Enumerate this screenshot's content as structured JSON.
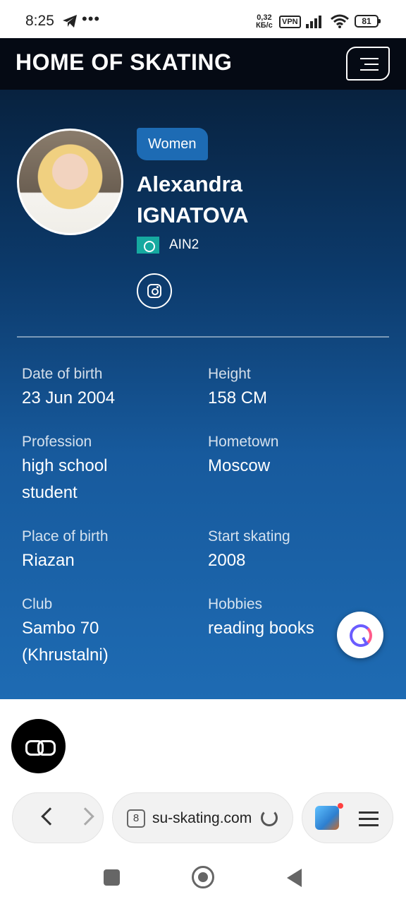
{
  "status_bar": {
    "time": "8:25",
    "dots": "•••",
    "speed_value": "0,32",
    "speed_unit": "КБ/c",
    "vpn": "VPN",
    "battery": "81",
    "icons": [
      "telegram-icon",
      "signal-icon",
      "wifi-icon",
      "battery-icon"
    ]
  },
  "header": {
    "site_title": "HOME OF SKATING",
    "menu_icon": "hamburger-icon"
  },
  "profile": {
    "category": "Women",
    "first_name": "Alexandra",
    "last_name": "IGNATOVA",
    "nation_code": "AIN2",
    "social_icon": "instagram-icon"
  },
  "info": [
    {
      "label": "Date of birth",
      "value": "23 Jun 2004"
    },
    {
      "label": "Height",
      "value": "158 CM"
    },
    {
      "label": "Profession",
      "value": "high school student"
    },
    {
      "label": "Hometown",
      "value": "Moscow"
    },
    {
      "label": "Place of birth",
      "value": "Riazan"
    },
    {
      "label": "Start skating",
      "value": "2008"
    },
    {
      "label": "Club",
      "value": "Sambo 70 (Khrustalni)"
    },
    {
      "label": "Hobbies",
      "value": "reading books"
    }
  ],
  "browser": {
    "tab_count": "8",
    "url": "su-skating.com"
  },
  "colors": {
    "header_bg": "#050a14",
    "hero_top": "#08223f",
    "hero_bottom": "#1e6bb3",
    "badge": "#1d6bb4",
    "flag": "#16a9a0"
  }
}
